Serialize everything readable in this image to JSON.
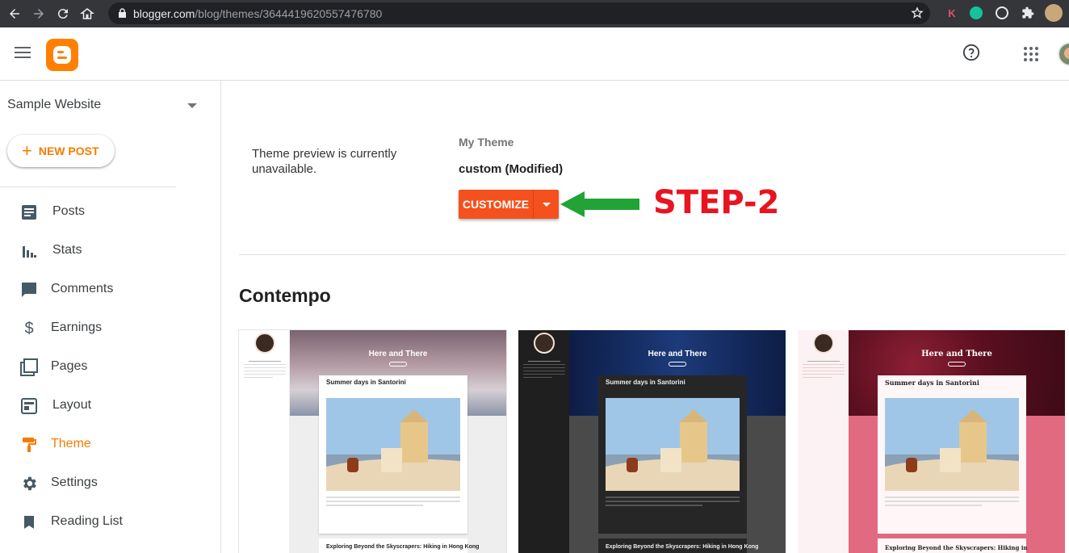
{
  "browser": {
    "url_host": "blogger.com",
    "url_path": "/blog/themes/3644419620557476780"
  },
  "sidebar": {
    "blog_name": "Sample Website",
    "new_post_label": "NEW POST",
    "items": [
      {
        "label": "Posts",
        "icon": "posts-icon"
      },
      {
        "label": "Stats",
        "icon": "stats-icon"
      },
      {
        "label": "Comments",
        "icon": "comments-icon"
      },
      {
        "label": "Earnings",
        "icon": "dollar-icon"
      },
      {
        "label": "Pages",
        "icon": "pages-icon"
      },
      {
        "label": "Layout",
        "icon": "layout-icon"
      },
      {
        "label": "Theme",
        "icon": "paint-roller-icon",
        "active": true
      },
      {
        "label": "Settings",
        "icon": "gear-icon"
      },
      {
        "label": "Reading List",
        "icon": "bookmark-icon"
      }
    ]
  },
  "main": {
    "preview_message": "Theme preview is currently unavailable.",
    "my_theme_label": "My Theme",
    "theme_name": "custom (Modified)",
    "customize_label": "CUSTOMIZE",
    "annotation": "STEP-2",
    "section_title": "Contempo"
  },
  "cards": [
    {
      "hero_title": "Here and There",
      "post_title": "Summer days in Santorini",
      "post2_title": "Exploring Beyond the Skyscrapers: Hiking in Hong Kong"
    },
    {
      "hero_title": "Here and There",
      "post_title": "Summer days in Santorini",
      "post2_title": "Exploring Beyond the Skyscrapers: Hiking in Hong Kong"
    },
    {
      "hero_title": "Here and There",
      "post_title": "Summer days in Santorini",
      "post2_title": "Exploring Beyond the Skyscrapers: Hiking in"
    }
  ],
  "colors": {
    "accent": "#f57c00",
    "customize": "#f4511e",
    "annotation": "#e8141f",
    "arrow": "#22a336"
  }
}
